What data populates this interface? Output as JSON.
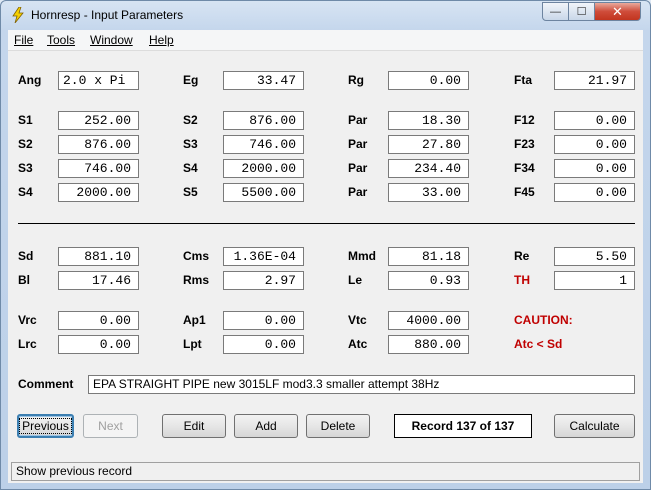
{
  "window": {
    "title": "Hornresp - Input Parameters",
    "min": "—",
    "max": "☐",
    "close": "✕"
  },
  "menu": [
    "File",
    "Tools",
    "Window",
    "Help"
  ],
  "row_ang": [
    {
      "label": "Ang",
      "value": "2.0 x Pi"
    },
    {
      "label": "Eg",
      "value": "33.47"
    },
    {
      "label": "Rg",
      "value": "0.00"
    },
    {
      "label": "Fta",
      "value": "21.97"
    }
  ],
  "rows_s": [
    [
      {
        "label": "S1",
        "value": "252.00"
      },
      {
        "label": "S2",
        "value": "876.00"
      },
      {
        "label": "Par",
        "value": "18.30"
      },
      {
        "label": "F12",
        "value": "0.00"
      }
    ],
    [
      {
        "label": "S2",
        "value": "876.00"
      },
      {
        "label": "S3",
        "value": "746.00"
      },
      {
        "label": "Par",
        "value": "27.80"
      },
      {
        "label": "F23",
        "value": "0.00"
      }
    ],
    [
      {
        "label": "S3",
        "value": "746.00"
      },
      {
        "label": "S4",
        "value": "2000.00"
      },
      {
        "label": "Par",
        "value": "234.40"
      },
      {
        "label": "F34",
        "value": "0.00"
      }
    ],
    [
      {
        "label": "S4",
        "value": "2000.00"
      },
      {
        "label": "S5",
        "value": "5500.00"
      },
      {
        "label": "Par",
        "value": "33.00"
      },
      {
        "label": "F45",
        "value": "0.00"
      }
    ]
  ],
  "rows_drv": [
    [
      {
        "label": "Sd",
        "value": "881.10"
      },
      {
        "label": "Cms",
        "value": "1.36E-04"
      },
      {
        "label": "Mmd",
        "value": "81.18"
      },
      {
        "label": "Re",
        "value": "5.50"
      }
    ],
    [
      {
        "label": "Bl",
        "value": "17.46"
      },
      {
        "label": "Rms",
        "value": "2.97"
      },
      {
        "label": "Le",
        "value": "0.93"
      },
      {
        "label": "TH",
        "value": "1"
      }
    ]
  ],
  "rows_ch": [
    [
      {
        "label": "Vrc",
        "value": "0.00"
      },
      {
        "label": "Ap1",
        "value": "0.00"
      },
      {
        "label": "Vtc",
        "value": "4000.00"
      },
      {
        "label": "CAUTION:"
      }
    ],
    [
      {
        "label": "Lrc",
        "value": "0.00"
      },
      {
        "label": "Lpt",
        "value": "0.00"
      },
      {
        "label": "Atc",
        "value": "880.00"
      },
      {
        "label": "Atc < Sd"
      }
    ]
  ],
  "comment": {
    "label": "Comment",
    "value": "EPA STRAIGHT PIPE new 3015LF mod3.3 smaller attempt 38Hz"
  },
  "buttons": {
    "previous": "Previous",
    "next": "Next",
    "edit": "Edit",
    "add": "Add",
    "delete": "Delete",
    "calculate": "Calculate"
  },
  "record": "Record 137 of 137",
  "status": "Show previous record",
  "colors": {
    "warning": "#c00000",
    "title_bar": "#c4d6ec"
  }
}
